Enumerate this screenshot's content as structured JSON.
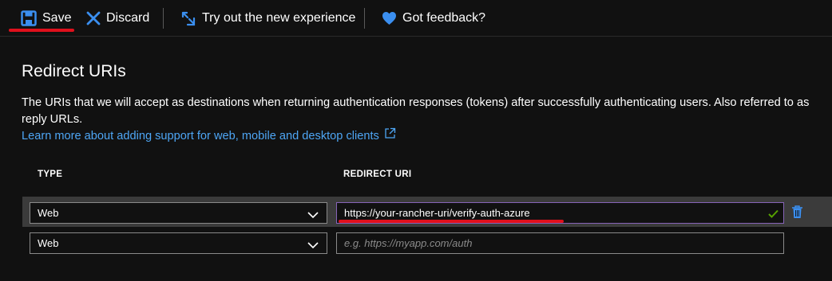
{
  "toolbar": {
    "save_label": "Save",
    "discard_label": "Discard",
    "try_label": "Try out the new experience",
    "feedback_label": "Got feedback?"
  },
  "section": {
    "title": "Redirect URIs",
    "description": "The URIs that we will accept as destinations when returning authentication responses (tokens) after successfully authenticating users. Also referred to as reply URLs.",
    "learn_more": "Learn more about adding support for web, mobile and desktop clients"
  },
  "table": {
    "headers": {
      "type": "TYPE",
      "redirect_uri": "REDIRECT URI"
    },
    "rows": [
      {
        "type": "Web",
        "uri": "https://your-rancher-uri/verify-auth-azure"
      },
      {
        "type": "Web",
        "uri": ""
      }
    ],
    "new_uri_placeholder": "e.g. https://myapp.com/auth"
  },
  "colors": {
    "background": "#111111",
    "link": "#4ea6f5",
    "accent_blue": "#3b8ff0",
    "annotation_red": "#e0101c",
    "valid_green": "#57a300",
    "focus_purple": "#8764b8",
    "row_highlight": "#3b3b3b"
  },
  "icons": {
    "save": "floppy-disk-icon",
    "discard": "x-icon",
    "try": "arrows-icon",
    "feedback": "heart-icon",
    "external": "external-link-icon",
    "chevron": "chevron-down-icon",
    "valid": "checkmark-icon",
    "delete": "trash-icon"
  }
}
